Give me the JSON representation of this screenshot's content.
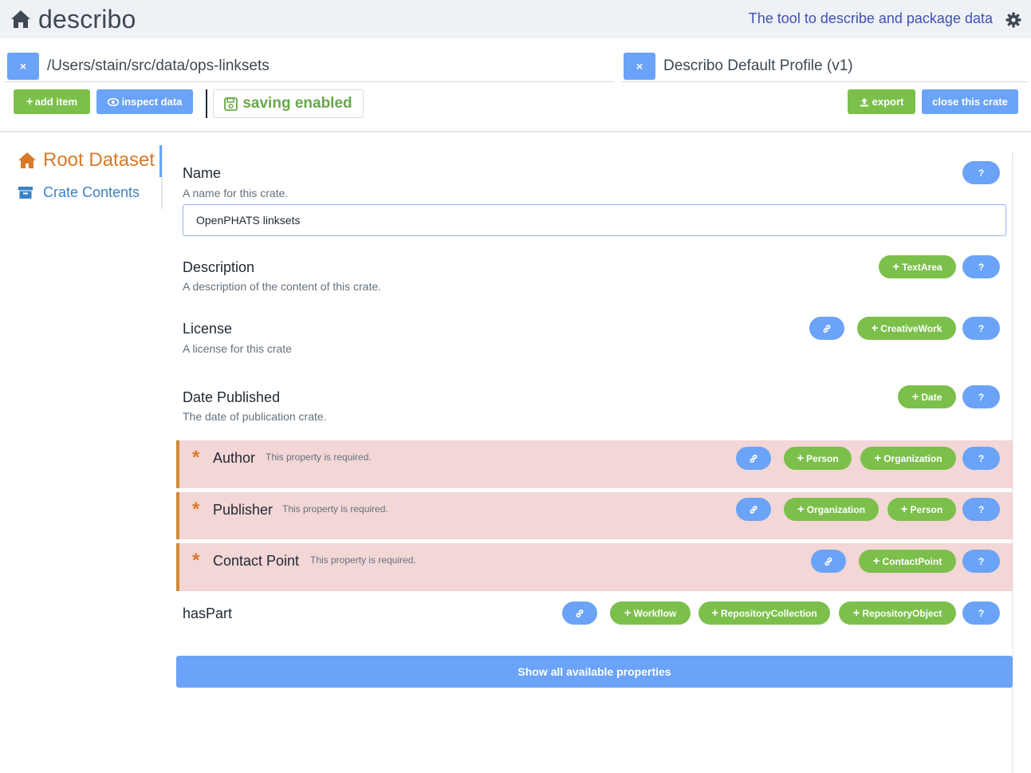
{
  "header": {
    "brand": "describo",
    "tagline": "The tool to describe and package data",
    "icons": [
      "home-icon",
      "gear-icon"
    ]
  },
  "paths": {
    "folder": "/Users/stain/src/data/ops-linksets",
    "profile": "Describo Default Profile (v1)",
    "close_label": "×"
  },
  "toolbar": {
    "add_item": "add item",
    "inspect_data": "inspect data",
    "saving": "saving enabled",
    "export": "export",
    "close_crate": "close this crate"
  },
  "nav": {
    "root": "Root Dataset",
    "crate": "Crate Contents"
  },
  "properties": {
    "name": {
      "label": "Name",
      "help": "A name for this crate.",
      "value": "OpenPHATS linksets"
    },
    "description": {
      "label": "Description",
      "help": "A description of the content of this crate.",
      "add": "TextArea"
    },
    "license": {
      "label": "License",
      "help": "A license for this crate",
      "add": "CreativeWork"
    },
    "date": {
      "label": "Date Published",
      "help": "The date of publication crate.",
      "add": "Date"
    },
    "author": {
      "label": "Author",
      "msg": "This property is required.",
      "add1": "Person",
      "add2": "Organization"
    },
    "publisher": {
      "label": "Publisher",
      "msg": "This property is required.",
      "add1": "Organization",
      "add2": "Person"
    },
    "contact": {
      "label": "Contact Point",
      "msg": "This property is required.",
      "add": "ContactPoint"
    },
    "haspart": {
      "label": "hasPart",
      "add1": "Workflow",
      "add2": "RepositoryCollection",
      "add3": "RepositoryObject"
    }
  },
  "help_label": "?",
  "plus": "+",
  "show_all": "Show all available properties",
  "colors": {
    "green": "#7cc04b",
    "blue": "#6aa3f8",
    "orange": "#d97a2a",
    "required_bg": "#f3d6d6"
  }
}
